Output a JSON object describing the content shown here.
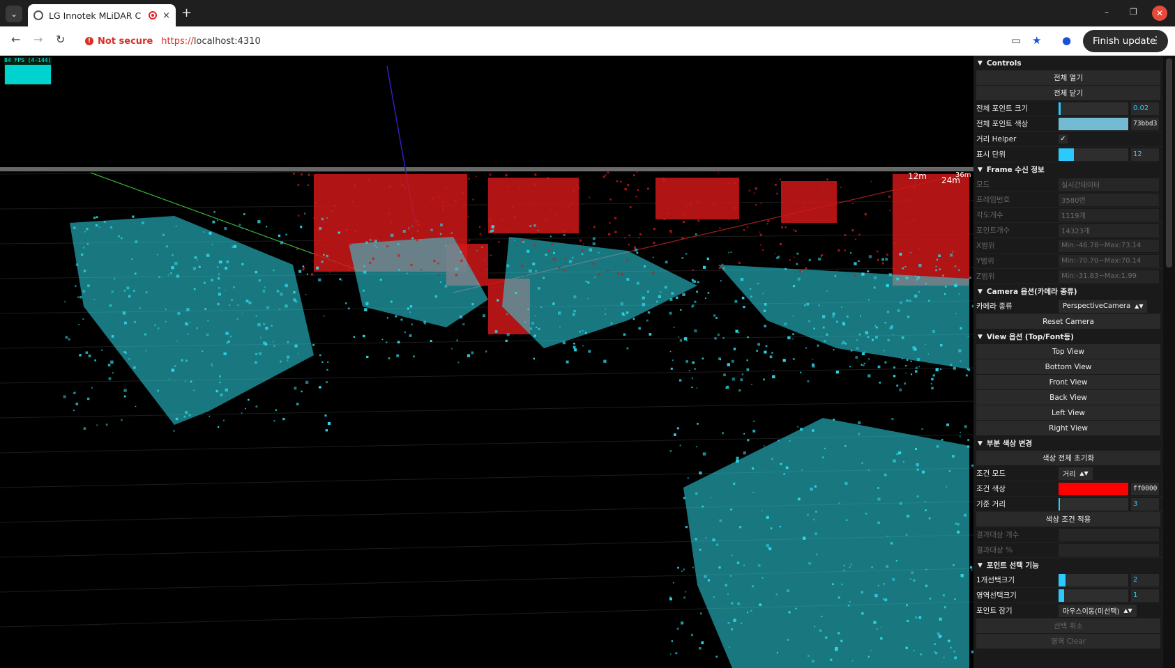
{
  "browser": {
    "tab_title": "LG Innotek MLiDAR C",
    "tab_close": "×",
    "new_tab": "+",
    "not_secure": "Not secure",
    "url_scheme": "https://",
    "url_host": "localhost:4310",
    "finish_update": "Finish update",
    "window_minimize": "–",
    "window_restore": "❐",
    "window_close": "✕"
  },
  "viewport": {
    "fps_label": "84 FPS (4-144)",
    "distance_labels": [
      "12m",
      "24m",
      "36m"
    ],
    "colors": {
      "cyan": "#2ed8e8",
      "red": "#d01818",
      "background": "#000000"
    }
  },
  "controls": {
    "title": "Controls",
    "open_all": "전체 열기",
    "close_all": "전체 닫기",
    "rows_main": [
      {
        "label": "전체 포인트 크기",
        "kind": "slider",
        "value": "0.02",
        "fill": 0.03
      },
      {
        "label": "전체 포인트 색상",
        "kind": "color",
        "value": "73bbd3",
        "color": "#73bbd3"
      },
      {
        "label": "거리 Helper",
        "kind": "check",
        "value": "✓"
      },
      {
        "label": "표시 단위",
        "kind": "slider",
        "value": "12",
        "fill": 0.22
      }
    ],
    "frame_section": {
      "title": "Frame 수신 정보",
      "rows": [
        {
          "label": "모드",
          "value": "실시간데이터"
        },
        {
          "label": "프레임번호",
          "value": "3580번"
        },
        {
          "label": "각도개수",
          "value": "1119개"
        },
        {
          "label": "포인트개수",
          "value": "14323개"
        },
        {
          "label": "X범위",
          "value": "Min:-46.78~Max:73.14"
        },
        {
          "label": "Y범위",
          "value": "Min:-70.70~Max:70.14"
        },
        {
          "label": "Z범위",
          "value": "Min:-31.83~Max:1.99"
        }
      ]
    },
    "camera_section": {
      "title": "Camera 옵션(카메라 종류)",
      "camera_type_label": "카메라 종류",
      "camera_type_value": "PerspectiveCamera",
      "reset_camera": "Reset Camera"
    },
    "view_section": {
      "title": "View 옵션 (Top/Font등)",
      "buttons": [
        "Top View",
        "Bottom View",
        "Front View",
        "Back View",
        "Left View",
        "Right View"
      ]
    },
    "color_section": {
      "title": "부분 색상 변경",
      "reset_all": "색상 전체 초기화",
      "condition_mode_label": "조건 모드",
      "condition_mode_value": "거리",
      "condition_color_label": "조건 색상",
      "condition_color_value": "ff0000",
      "condition_color": "#ff0000",
      "base_distance_label": "기준 거리",
      "base_distance_value": "3",
      "base_distance_fill": 0.02,
      "apply": "색상 조건 적용",
      "result_count_label": "결과대상 개수",
      "result_pct_label": "결과대상 %"
    },
    "select_section": {
      "title": "포인트 선택 기능",
      "single_size_label": "1개선택크기",
      "single_size_value": "2",
      "single_size_fill": 0.1,
      "area_size_label": "영역선택크기",
      "area_size_value": "1",
      "area_size_fill": 0.08,
      "point_lock_label": "포인트 잠기",
      "point_lock_value": "마우스이동(미선택)",
      "cancel_select": "선택 취소",
      "area_clear": "영역 Clear"
    }
  }
}
